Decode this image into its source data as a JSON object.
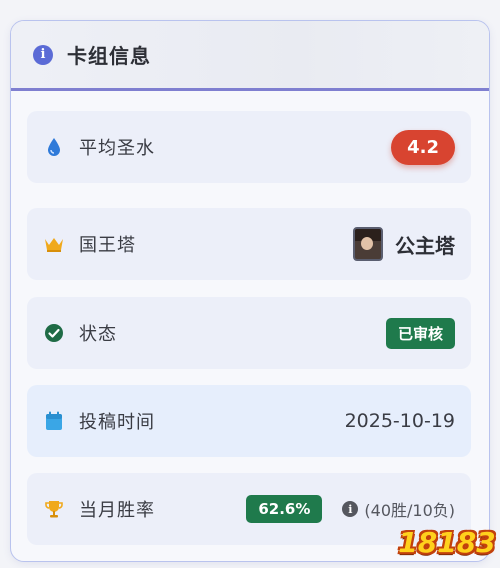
{
  "header": {
    "title": "卡组信息",
    "icon": "info-icon"
  },
  "rows": {
    "elixir": {
      "label": "平均圣水",
      "value": "4.2",
      "icon": "water-drop-icon",
      "color": "#d84430"
    },
    "tower": {
      "label": "国王塔",
      "value": "公主塔",
      "icon": "crown-icon"
    },
    "status": {
      "label": "状态",
      "value": "已审核",
      "icon": "check-circle-icon",
      "color": "#1f7a4c"
    },
    "submit_time": {
      "label": "投稿时间",
      "value": "2025-10-19",
      "icon": "calendar-icon"
    },
    "win_rate": {
      "label": "当月胜率",
      "value": "62.6%",
      "detail": "(40胜/10负)",
      "icon": "trophy-icon"
    }
  },
  "watermark": {
    "text": "18183"
  }
}
